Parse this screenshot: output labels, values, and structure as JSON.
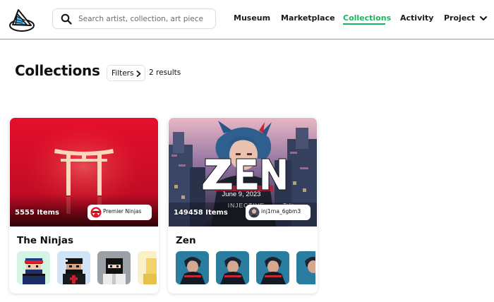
{
  "header": {
    "logo_icon": "canvas-logo-icon",
    "search": {
      "placeholder": "Search artist, collection, art piece",
      "value": "",
      "icon": "search-icon"
    },
    "nav": [
      {
        "label": "Museum",
        "active": false
      },
      {
        "label": "Marketplace",
        "active": false
      },
      {
        "label": "Collections",
        "active": true
      },
      {
        "label": "Activity",
        "active": false
      },
      {
        "label": "Project",
        "active": false,
        "icon": "chevron-down-icon"
      }
    ],
    "accent_color": "#18b85a"
  },
  "page": {
    "title": "Collections",
    "filters_label": "Filters",
    "filters_icon": "chevron-right-icon",
    "results_text": "2 results"
  },
  "collections": [
    {
      "name": "The Ninjas",
      "items_text": "5555 Items",
      "creator": "Premier Ninjas",
      "banner_art": "torii-gate",
      "banner_color": "#d8102a",
      "thumbnails": [
        "ninja-blue",
        "ninja-red",
        "ninja-grey",
        "ninja-yellow"
      ]
    },
    {
      "name": "Zen",
      "items_text": "149458 Items",
      "creator": "inj1rna_6gbm3",
      "banner_art": "zen-anime-city",
      "banner_color": "#3a5d86",
      "thumbnails": [
        "zen-anime-1",
        "zen-anime-2",
        "zen-anime-3",
        "zen-anime-4"
      ]
    }
  ]
}
